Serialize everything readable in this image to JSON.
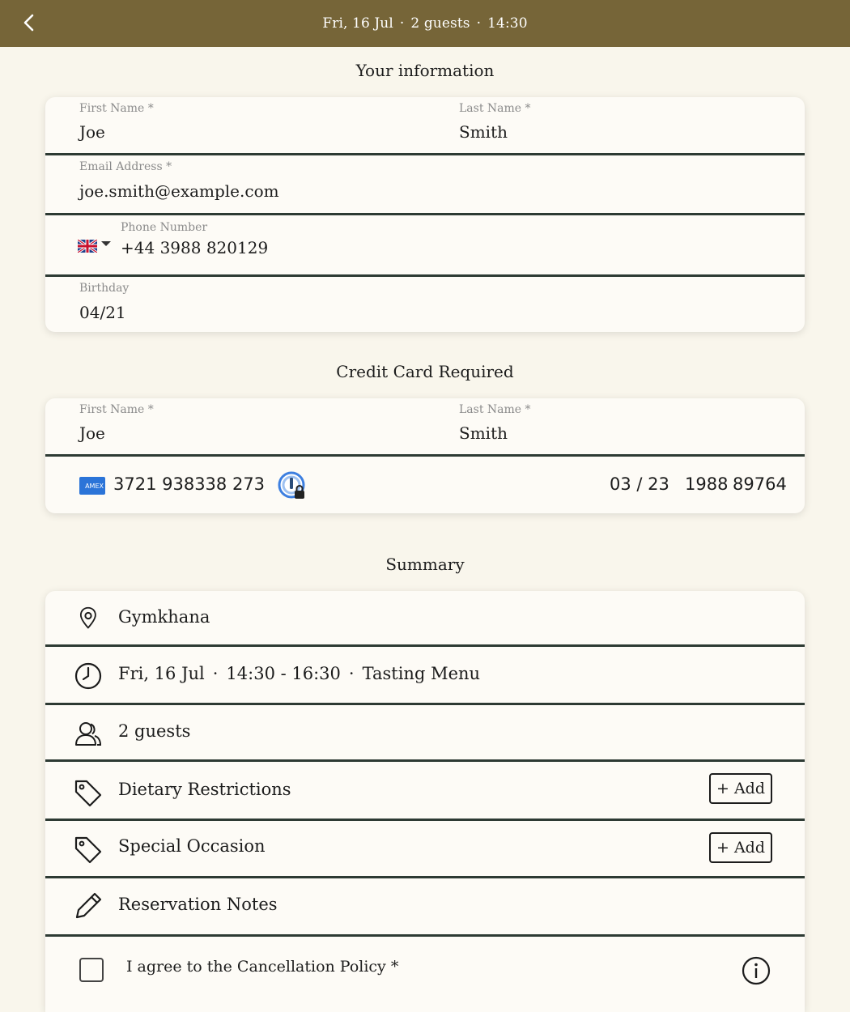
{
  "header": {
    "date": "Fri, 16 Jul",
    "guests": "2 guests",
    "time": "14:30",
    "separator": "·"
  },
  "your_info": {
    "title": "Your information",
    "first_name_label": "First Name *",
    "first_name_value": "Joe",
    "last_name_label": "Last Name *",
    "last_name_value": "Smith",
    "email_label": "Email Address *",
    "email_value": "joe.smith@example.com",
    "phone_label": "Phone Number",
    "phone_value": "+44 3988 820129",
    "phone_country_icon": "uk-flag-icon",
    "birthday_label": "Birthday",
    "birthday_value": "04/21"
  },
  "credit_card": {
    "title": "Credit Card Required",
    "first_name_label": "First Name *",
    "first_name_value": "Joe",
    "last_name_label": "Last Name *",
    "last_name_value": "Smith",
    "card_brand": "AMEX",
    "card_number": "3721 938338 273",
    "expiry": "03 / 23",
    "cvc": "1988",
    "postal": "89764"
  },
  "summary": {
    "title": "Summary",
    "venue": "Gymkhana",
    "date": "Fri, 16 Jul",
    "time_range": "14:30 - 16:30",
    "menu": "Tasting Menu",
    "guests": "2 guests",
    "dietary_label": "Dietary Restrictions",
    "occasion_label": "Special Occasion",
    "add_label": "+ Add",
    "notes_label": "Reservation Notes",
    "agree_label": "I agree to the Cancellation Policy *"
  },
  "colors": {
    "header_bg": "#766538",
    "page_bg": "#f9f6ec",
    "divider": "#2d3a33"
  }
}
